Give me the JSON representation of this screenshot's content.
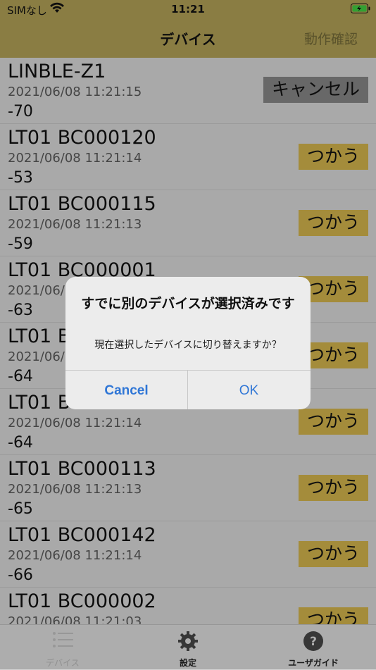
{
  "status": {
    "carrier": "SIMなし",
    "time": "11:21"
  },
  "nav": {
    "title": "デバイス",
    "right": "動作確認"
  },
  "devices": [
    {
      "name": "LINBLE-Z1",
      "timestamp": "2021/06/08 11:21:15",
      "rssi": "-70",
      "button": "キャンセル"
    },
    {
      "name": "LT01 BC000120",
      "timestamp": "2021/06/08 11:21:14",
      "rssi": "-53",
      "button": "つかう"
    },
    {
      "name": "LT01 BC000115",
      "timestamp": "2021/06/08 11:21:13",
      "rssi": "-59",
      "button": "つかう"
    },
    {
      "name": "LT01 BC000001",
      "timestamp": "2021/06/",
      "rssi": "-63",
      "button": "つかう"
    },
    {
      "name": "LT01 B",
      "timestamp": "2021/06/",
      "rssi": "-64",
      "button": "つかう"
    },
    {
      "name": "LT01 B",
      "timestamp": "2021/06/08 11:21:14",
      "rssi": "-64",
      "button": "つかう"
    },
    {
      "name": "LT01 BC000113",
      "timestamp": "2021/06/08 11:21:13",
      "rssi": "-65",
      "button": "つかう"
    },
    {
      "name": "LT01 BC000142",
      "timestamp": "2021/06/08 11:21:14",
      "rssi": "-66",
      "button": "つかう"
    },
    {
      "name": "LT01 BC000002",
      "timestamp": "2021/06/08 11:21:03",
      "rssi": "",
      "button": "つかう"
    }
  ],
  "tabs": [
    {
      "label": "デバイス",
      "icon": "list-icon"
    },
    {
      "label": "設定",
      "icon": "gear-icon"
    },
    {
      "label": "ユーザガイド",
      "icon": "question-icon"
    }
  ],
  "dialog": {
    "title": "すでに別のデバイスが選択済みです",
    "message": "現在選択したデバイスに切り替えますか？",
    "cancel": "Cancel",
    "ok": "OK"
  }
}
